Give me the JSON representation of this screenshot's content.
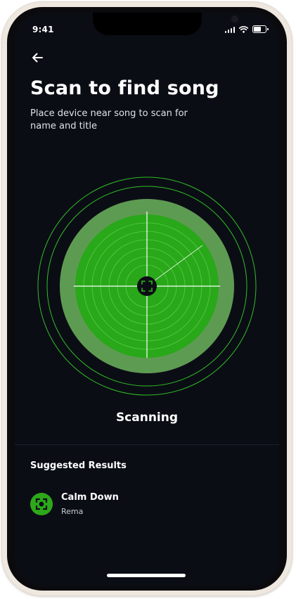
{
  "status_bar": {
    "time": "9:41"
  },
  "header": {
    "back_icon": "arrow-left-icon",
    "title": "Scan to find song",
    "subtitle": "Place device near song to scan for name and title"
  },
  "scanner": {
    "status": "Scanning",
    "center_icon": "scan-frame-icon",
    "colors": {
      "outer_ring": "#5e9b52",
      "disc": "#29a81a",
      "glow_rings": "#2fbf25",
      "background": "#0b0d15"
    }
  },
  "results": {
    "heading": "Suggested Results",
    "items": [
      {
        "title": "Calm Down",
        "artist": "Rema",
        "icon": "scan-frame-icon"
      }
    ]
  }
}
